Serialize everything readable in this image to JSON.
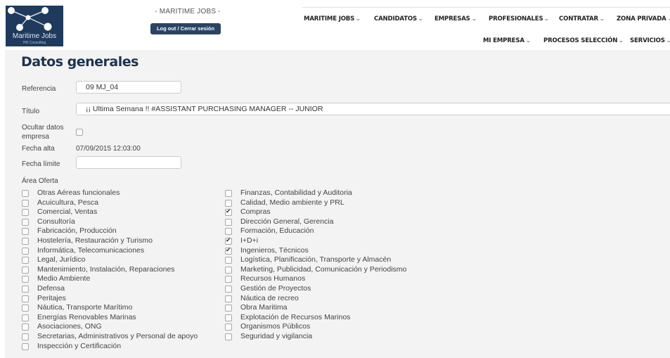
{
  "header": {
    "logo_name": "Maritime Jobs",
    "logo_sub": "HR Consulting",
    "brand": "- MARITIME JOBS -",
    "logout_label": "Log out / Cerrar sesión",
    "nav_row1": [
      "MARITIME JOBS",
      "CANDIDATOS",
      "EMPRESAS",
      "PROFESIONALES",
      "CONTRATAR",
      "ZONA PRIVADA"
    ],
    "nav_row2": [
      "MI EMPRESA",
      "PROCESOS SELECCIÓN",
      "SERVICIOS"
    ]
  },
  "form": {
    "title": "Datos generales",
    "referencia_label": "Referencia",
    "referencia_value": "09 MJ_04",
    "titulo_label": "Título",
    "titulo_value": "¡¡ Ultima Semana !! #ASSISTANT PURCHASING MANAGER  --  JUNIOR",
    "ocultar_label_1": "Ocultar datos",
    "ocultar_label_2": "empresa",
    "ocultar_checked": false,
    "fecha_alta_label": "Fecha alta",
    "fecha_alta_value": "07/09/2015 12:03:00",
    "fecha_limite_label": "Fecha límite",
    "fecha_limite_value": "",
    "area_label": "Área Oferta"
  },
  "areas_left": [
    {
      "label": " Otras Aéreas funcionales",
      "checked": false
    },
    {
      "label": "Acuicultura, Pesca",
      "checked": false
    },
    {
      "label": "Comercial, Ventas",
      "checked": false
    },
    {
      "label": "Consultoría",
      "checked": false
    },
    {
      "label": "Fabricación, Producción",
      "checked": false
    },
    {
      "label": "Hostelería, Restauración y Turismo",
      "checked": false
    },
    {
      "label": "Informática, Telecomunicaciones",
      "checked": false
    },
    {
      "label": "Legal, Jurídico",
      "checked": false
    },
    {
      "label": "Mantenimiento, Instalación, Reparaciones",
      "checked": false
    },
    {
      "label": "Medio Ambiente",
      "checked": false
    },
    {
      "label": "Defensa",
      "checked": false
    },
    {
      "label": "Peritajes",
      "checked": false
    },
    {
      "label": "Náutica, Transporte Marítimo",
      "checked": false
    },
    {
      "label": "Energías Renovables Marinas",
      "checked": false
    },
    {
      "label": "Asociaciones, ONG",
      "checked": false
    },
    {
      "label": "Secretarias, Administrativos y Personal de apoyo",
      "checked": false
    },
    {
      "label": "Inspección y Certificación",
      "checked": false
    }
  ],
  "areas_right": [
    {
      "label": "Finanzas, Contabilidad y Auditoria",
      "checked": false
    },
    {
      "label": "Calidad, Medio ambiente y PRL",
      "checked": false
    },
    {
      "label": "Compras",
      "checked": true
    },
    {
      "label": "Dirección General, Gerencia",
      "checked": false
    },
    {
      "label": "Formación, Educación",
      "checked": false
    },
    {
      "label": "I+D+i",
      "checked": true
    },
    {
      "label": "Ingenieros, Técnicos",
      "checked": true
    },
    {
      "label": "Logística, Planificación, Transporte  y Almacén",
      "checked": false
    },
    {
      "label": "Marketing, Publicidad, Comunicación  y Periodismo",
      "checked": false
    },
    {
      "label": "Recursos Humanos",
      "checked": false
    },
    {
      "label": "Gestión de Proyectos",
      "checked": false
    },
    {
      "label": "Náutica de recreo",
      "checked": false
    },
    {
      "label": "Obra Maritima",
      "checked": false
    },
    {
      "label": "Explotación de Recursos Marinos",
      "checked": false
    },
    {
      "label": "Organismos Públicos",
      "checked": false
    },
    {
      "label": "Seguridad y vigilancia",
      "checked": false
    }
  ]
}
